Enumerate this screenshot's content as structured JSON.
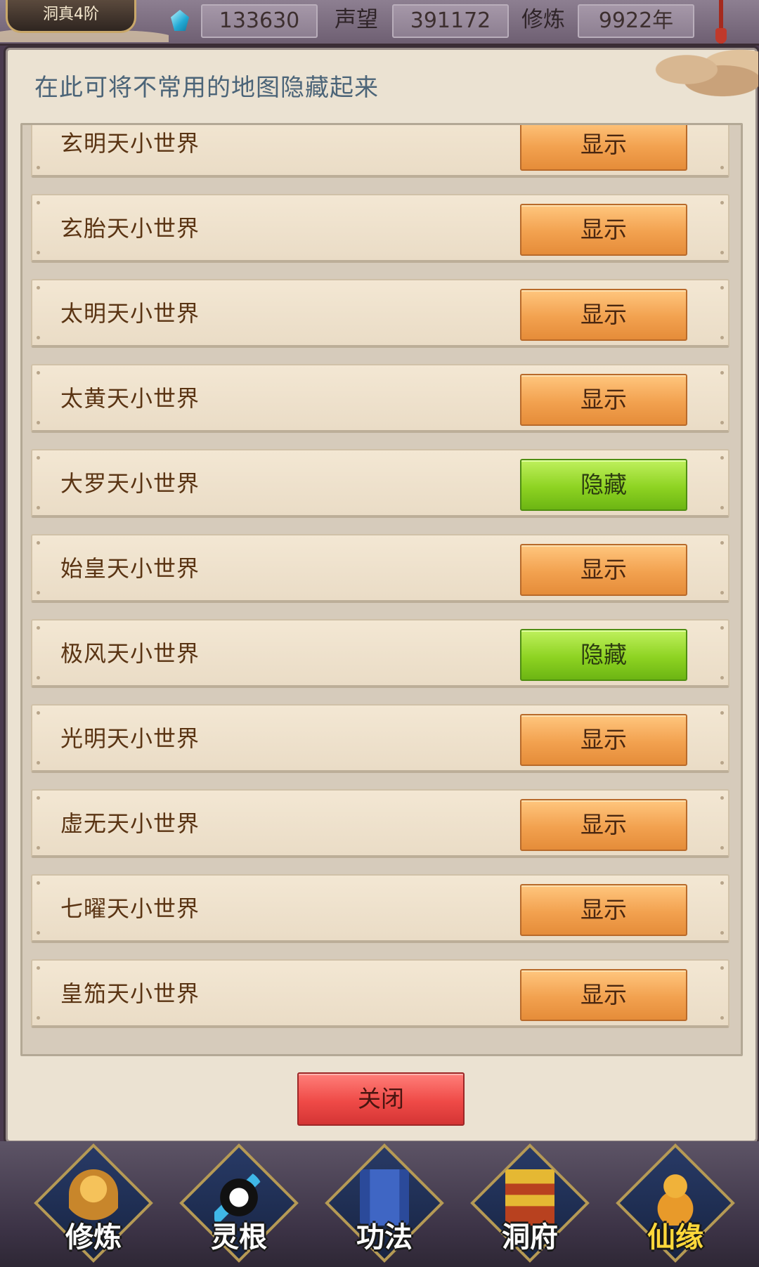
{
  "topbar": {
    "rank": "洞真4阶",
    "gem_count": "133630",
    "prestige_label": "声望",
    "prestige_value": "391172",
    "cultivation_label": "修炼",
    "cultivation_value": "9922年"
  },
  "panel": {
    "header": "在此可将不常用的地图隐藏起来",
    "rows": [
      {
        "name": "玄明天小世界",
        "button": "显示",
        "state": "show"
      },
      {
        "name": "玄胎天小世界",
        "button": "显示",
        "state": "show"
      },
      {
        "name": "太明天小世界",
        "button": "显示",
        "state": "show"
      },
      {
        "name": "太黄天小世界",
        "button": "显示",
        "state": "show"
      },
      {
        "name": "大罗天小世界",
        "button": "隐藏",
        "state": "hide"
      },
      {
        "name": "始皇天小世界",
        "button": "显示",
        "state": "show"
      },
      {
        "name": "极风天小世界",
        "button": "隐藏",
        "state": "hide"
      },
      {
        "name": "光明天小世界",
        "button": "显示",
        "state": "show"
      },
      {
        "name": "虚无天小世界",
        "button": "显示",
        "state": "show"
      },
      {
        "name": "七曜天小世界",
        "button": "显示",
        "state": "show"
      },
      {
        "name": "皇笳天小世界",
        "button": "显示",
        "state": "show"
      }
    ],
    "close_label": "关闭"
  },
  "bottom_nav": [
    {
      "label": "修炼",
      "icon": "monk-icon",
      "highlight": false
    },
    {
      "label": "灵根",
      "icon": "yin-yang-sword-icon",
      "highlight": false
    },
    {
      "label": "功法",
      "icon": "book-icon",
      "highlight": false
    },
    {
      "label": "洞府",
      "icon": "pagoda-icon",
      "highlight": false
    },
    {
      "label": "仙缘",
      "icon": "gourd-icon",
      "highlight": true
    }
  ],
  "colors": {
    "show_button": "#f2a14f",
    "hide_button": "#8ed322",
    "close_button": "#ef4a47",
    "header_text": "#4b6478",
    "row_text": "#5a3413"
  }
}
